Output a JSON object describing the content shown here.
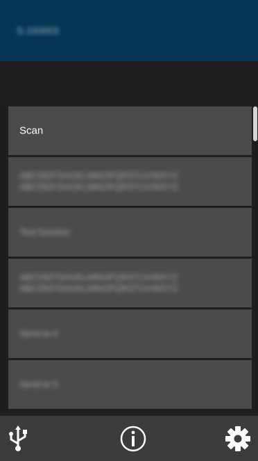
{
  "header": {
    "title": "S-150003"
  },
  "menu": {
    "items": [
      {
        "label": "Scan",
        "blurred": false
      },
      {
        "label": "ABCDEFGHIJKLMNOPQRSTUVWXYZ ABCDEFGHIJKLMNOPQRSTUVWXYZ",
        "blurred": true
      },
      {
        "label": "Test function",
        "blurred": true
      },
      {
        "label": "ABCDEFGHIJKLMNOPQRSTUVWXYZ ABCDEFGHIJKLMNOPQRSTUVWXYZ",
        "blurred": true
      },
      {
        "label": "Send to 4",
        "blurred": true
      },
      {
        "label": "Send to 5",
        "blurred": true
      }
    ]
  },
  "toolbar": {
    "icons": [
      "usb-icon",
      "info-icon",
      "gear-icon"
    ]
  },
  "colors": {
    "header_bg": "#063556",
    "item_bg": "#4a4a4a",
    "toolbar_bg": "#3c3c3c",
    "page_bg": "#1e1e1e"
  }
}
